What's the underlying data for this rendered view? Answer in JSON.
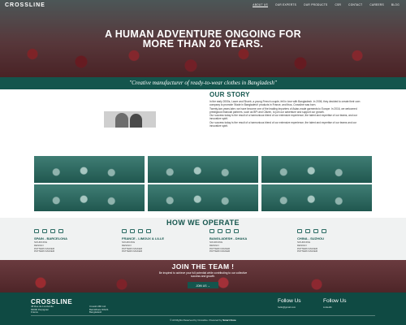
{
  "header": {
    "brand": "CROSSLINE",
    "nav": [
      "ABOUT US",
      "OUR EXPERTS",
      "OUR PRODUCTS",
      "CSR",
      "CONTACT",
      "CAREERS",
      "BLOG"
    ],
    "hero_title_line1": "A HUMAN ADVENTURE ONGOING FOR",
    "hero_title_line2": "MORE THAN 20 YEARS."
  },
  "tagline": "\"Creative manufacturer of ready-to-wear clothes in Bangladesh\"",
  "story": {
    "title": "OUR STORY",
    "paragraphs": [
      "In the early 2000s, Laure and Shoeb, a young French couple, fell in love with Bangladesh. In 2006, they decided to create their own company to promote 'Made in Bangladesh' products in France, and thus, Crossline was born.",
      "Twenty-two years later, we have become one of the leading importers of Asian-made garments to Europe. In 2016, we welcomed prestigious financial partners, such as BPI and Citizen, to join our adventure and support our growth.",
      "Our success today is the result of a harmonious blend of our extensive experience, the talent and expertise of our teams, and our innovative spirit.",
      "Our success today is the result of a harmonious blend of our extensive experience, the talent and expertise of our teams and our innovative spirit."
    ]
  },
  "operate": {
    "title": "HOW WE OPERATE",
    "columns": [
      {
        "heading": "SPAIN - BARCELONA",
        "items": [
          "SOURCING",
          "DESIGN",
          "PATTERN MAKER",
          "PATTERN MAKER"
        ]
      },
      {
        "heading": "FRANCE - LIMOUX & LILLE",
        "items": [
          "SOURCING",
          "DESIGN",
          "PATTERN MAKER",
          "PATTERN MAKER"
        ]
      },
      {
        "heading": "BANGLADESH - DHAKA",
        "items": [
          "SOURCING",
          "DESIGN",
          "PATTERN MAKER",
          "PATTERN MAKER"
        ]
      },
      {
        "heading": "CHINA - SUZHOU",
        "items": [
          "SOURCING",
          "DESIGN",
          "PATTERN MAKER",
          "PATTERN MAKER"
        ]
      }
    ]
  },
  "join": {
    "title": "JOIN THE TEAM !",
    "subtitle_line1": "Be inspired to achieve your full potential while contributing to our collective",
    "subtitle_line2": "success and growth.",
    "button": "JOIN US →"
  },
  "footer": {
    "brand": "CROSSLINE",
    "address1": [
      "48 Rue de Lombardie",
      "66000 Perpignan",
      "France"
    ],
    "address2": [
      "Crosslin BD Ltd.",
      "Bariddhara DOHS",
      "Bangladesh"
    ],
    "follow_heading1": "Follow Us",
    "email": "hello@gmail.com",
    "follow_heading2": "Follow Us",
    "social": "LinkedIn",
    "copyright_prefix": "© All Rights Reserved by Crossline. Powered by",
    "copyright_name": "Smart Zone"
  },
  "colors": {
    "brand_green": "#14554d",
    "footer_green": "#0f4a43"
  }
}
